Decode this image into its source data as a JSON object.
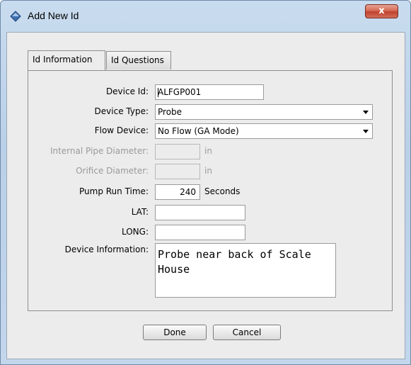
{
  "window": {
    "title": "Add New Id",
    "close_glyph": "x",
    "title_icon": "diamond-app-icon",
    "close_color": "#c94b36"
  },
  "tabs": [
    {
      "label": "Id Information",
      "active": true
    },
    {
      "label": "Id Questions",
      "active": false
    }
  ],
  "form": {
    "device_id": {
      "label": "Device Id:",
      "value": "ALFGP001"
    },
    "device_type": {
      "label": "Device Type:",
      "value": "Probe"
    },
    "flow_device": {
      "label": "Flow Device:",
      "value": "No Flow (GA Mode)"
    },
    "internal_pipe_diameter": {
      "label": "Internal Pipe Diameter:",
      "value": "",
      "unit": "in",
      "enabled": false
    },
    "orifice_diameter": {
      "label": "Orifice Diameter:",
      "value": "",
      "unit": "in",
      "enabled": false
    },
    "pump_run_time": {
      "label": "Pump Run Time:",
      "value": "240",
      "unit": "Seconds"
    },
    "lat": {
      "label": "LAT:",
      "value": ""
    },
    "long": {
      "label": "LONG:",
      "value": ""
    },
    "device_information": {
      "label": "Device Information:",
      "value": "Probe near back of Scale House"
    }
  },
  "buttons": {
    "done": "Done",
    "cancel": "Cancel"
  }
}
